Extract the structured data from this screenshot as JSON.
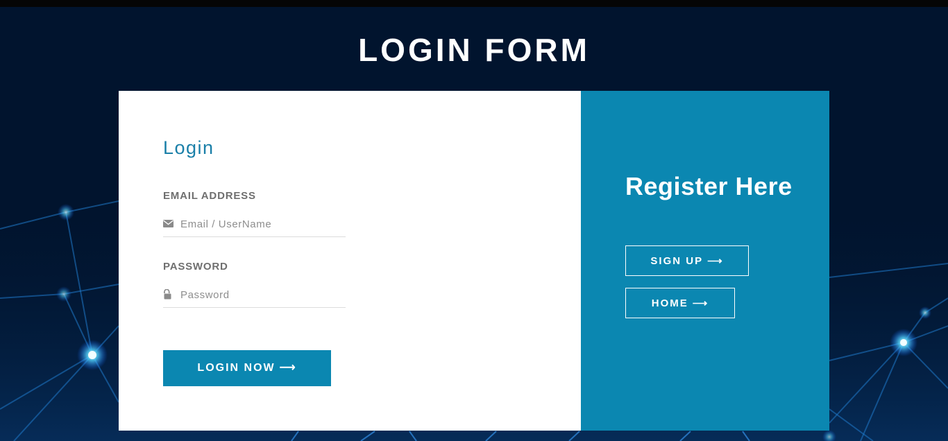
{
  "page": {
    "title": "LOGIN FORM"
  },
  "login": {
    "heading": "Login",
    "email_label": "EMAIL ADDRESS",
    "email_placeholder": "Email / UserName",
    "email_icon": "envelope-icon",
    "password_label": "PASSWORD",
    "password_placeholder": "Password",
    "password_icon": "lock-icon",
    "submit_label": "LOGIN NOW",
    "submit_icon": "arrow-right-icon"
  },
  "register": {
    "heading": "Register Here",
    "signup_label": "SIGN UP",
    "home_label": "HOME",
    "button_icon": "arrow-right-icon"
  },
  "colors": {
    "background": "#01142e",
    "accent": "#0b87b1",
    "heading_accent": "#1a7fa8",
    "card": "#ffffff"
  }
}
